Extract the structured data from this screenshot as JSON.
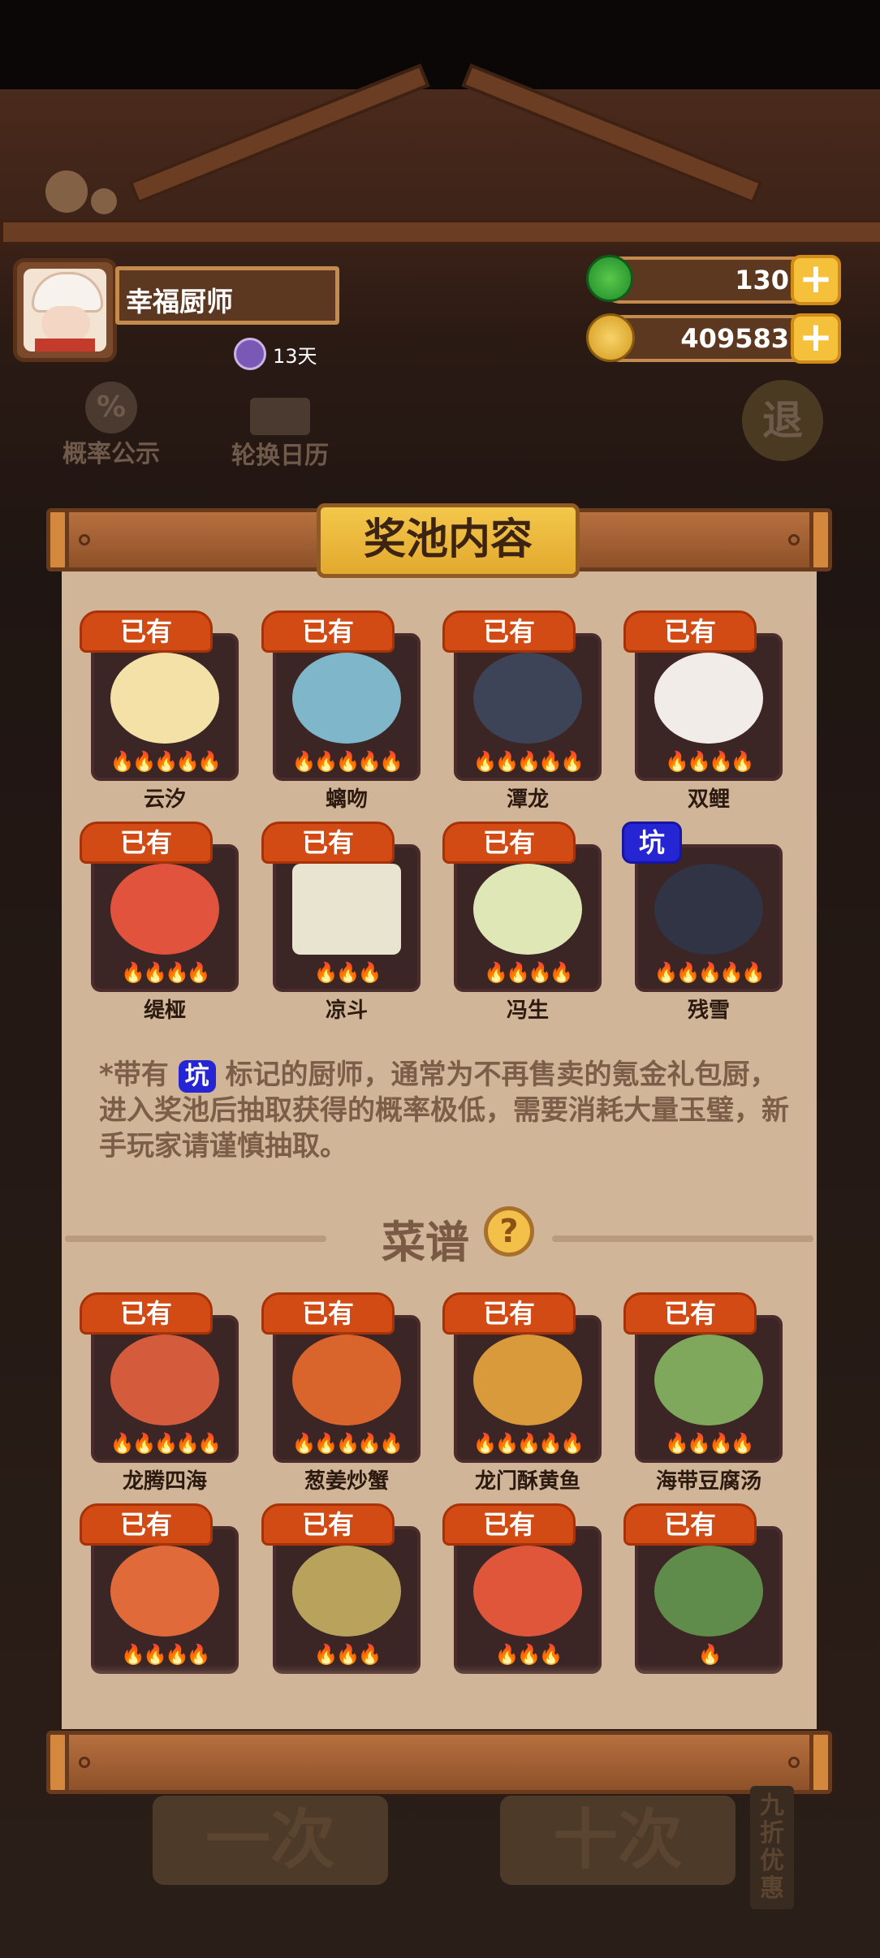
{
  "header": {
    "player_name": "幸福厨师",
    "badge_days": "13天",
    "jade_amount": "130",
    "coin_amount": "409583",
    "plus_label": "+"
  },
  "background_buttons": {
    "probability": "概率公示",
    "rotation": "轮换日历",
    "exit": "退",
    "draw_one": "一次",
    "draw_ten": "十次",
    "discount": "九折优惠"
  },
  "panel": {
    "title": "奖池内容",
    "chefs": [
      {
        "name": "云汐",
        "tag": "已有",
        "art": "#f3e1a8",
        "flames": "🔥🔥🔥🔥🔥"
      },
      {
        "name": "螭吻",
        "tag": "已有",
        "art": "#7fb6c9",
        "flames": "🔥🔥🔥🔥🔥"
      },
      {
        "name": "潭龙",
        "tag": "已有",
        "art": "#3d4457",
        "flames": "🔥🔥🔥🔥🔥"
      },
      {
        "name": "双鲤",
        "tag": "已有",
        "art": "#f1ece8",
        "flames": "🔥🔥🔥🔥"
      },
      {
        "name": "缇桠",
        "tag": "已有",
        "art": "#e2533e",
        "flames": "🔥🔥🔥🔥"
      },
      {
        "name": "凉斗",
        "tag": "已有",
        "art": "#e9e4cf",
        "flames": "🔥🔥🔥"
      },
      {
        "name": "冯生",
        "tag": "已有",
        "art": "#dfe7b6",
        "flames": "🔥🔥🔥🔥"
      },
      {
        "name": "残雪",
        "tag": "坑",
        "art": "#303445",
        "flames": "🔥🔥🔥🔥🔥"
      }
    ],
    "note_prefix": "*带有",
    "note_tag": "坑",
    "note_body": "标记的厨师，通常为不再售卖的氪金礼包厨，进入奖池后抽取获得的概率极低，需要消耗大量玉璧，新手玩家请谨慎抽取。",
    "recipes_title": "菜谱",
    "help_label": "?",
    "recipes": [
      {
        "name": "龙腾四海",
        "tag": "已有",
        "art": "#d45b3b",
        "flames": "🔥🔥🔥🔥🔥"
      },
      {
        "name": "葱姜炒蟹",
        "tag": "已有",
        "art": "#d9652d",
        "flames": "🔥🔥🔥🔥🔥"
      },
      {
        "name": "龙门酥黄鱼",
        "tag": "已有",
        "art": "#d89a3a",
        "flames": "🔥🔥🔥🔥🔥"
      },
      {
        "name": "海带豆腐汤",
        "tag": "已有",
        "art": "#7fa85d",
        "flames": "🔥🔥🔥🔥"
      },
      {
        "name": "",
        "tag": "已有",
        "art": "#e06a3a",
        "flames": "🔥🔥🔥🔥"
      },
      {
        "name": "",
        "tag": "已有",
        "art": "#b9a35c",
        "flames": "🔥🔥🔥"
      },
      {
        "name": "",
        "tag": "已有",
        "art": "#e0563a",
        "flames": "🔥🔥🔥"
      },
      {
        "name": "",
        "tag": "已有",
        "art": "#5f8c4a",
        "flames": "🔥"
      }
    ]
  }
}
